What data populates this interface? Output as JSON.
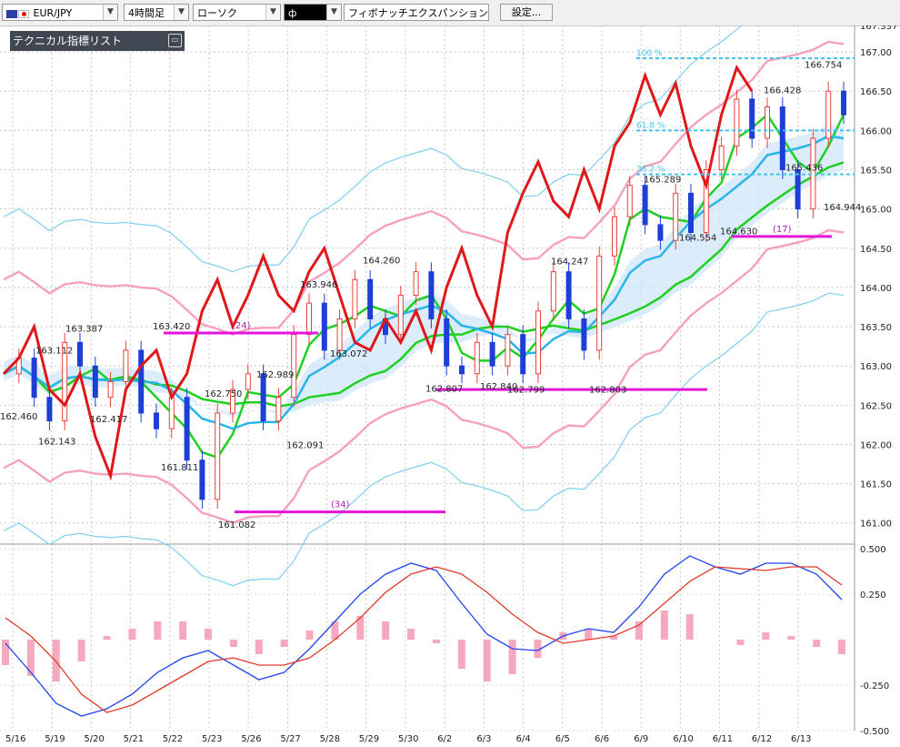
{
  "toolbar": {
    "pair": "EUR/JPY",
    "timeframe": "4時間足",
    "chart_style": "ローソク",
    "draw_tool_label": "ф",
    "draw_tool_name": "フィボナッチエクスパンション",
    "settings_label": "設定..."
  },
  "indicator_list": {
    "label": "テクニカル指標リスト"
  },
  "colors": {
    "candle_up": "#e8413a",
    "candle_down": "#1d3fd6",
    "ma_green": "#20d020",
    "ma_blue": "#2ab4e8",
    "bollinger_pink": "#f6a0bf",
    "bollinger_blue": "#7fcfef",
    "red_line": "#e01818",
    "cloud_pink": "#f9c8d9",
    "cloud_blue": "#cfe6f9",
    "fib": "#3cc4f0",
    "magenta": "#e414dc"
  },
  "chart_data": [
    {
      "type": "candlestick",
      "y_axis_labels": [
        "167.337",
        "167.00",
        "166.50",
        "166.00",
        "165.50",
        "165.00",
        "164.50",
        "164.00",
        "163.50",
        "163.00",
        "162.50",
        "162.00",
        "161.50",
        "161.00"
      ],
      "ylim": [
        160.8,
        167.337
      ],
      "x_labels": [
        "5/16",
        "5/19",
        "5/20",
        "5/21",
        "5/22",
        "5/23",
        "5/26",
        "5/27",
        "5/28",
        "5/29",
        "5/30",
        "6/2",
        "6/3",
        "6/4",
        "6/5",
        "6/6",
        "6/9",
        "6/10",
        "6/11",
        "6/12",
        "6/13"
      ],
      "price_annotations": [
        {
          "text": "162.460",
          "x": 0,
          "y": 162.46
        },
        {
          "text": "163.112",
          "x": 1.3,
          "y": 163.11
        },
        {
          "text": "162.143",
          "x": 1.4,
          "y": 162.14
        },
        {
          "text": "163.387",
          "x": 2.4,
          "y": 163.39
        },
        {
          "text": "162.417",
          "x": 3.3,
          "y": 162.42
        },
        {
          "text": "163.420",
          "x": 5.6,
          "y": 163.42
        },
        {
          "text": "161.811",
          "x": 5.9,
          "y": 161.81
        },
        {
          "text": "162.750",
          "x": 7.5,
          "y": 162.75
        },
        {
          "text": "161.082",
          "x": 8.0,
          "y": 161.08
        },
        {
          "text": "162.989",
          "x": 9.4,
          "y": 162.99
        },
        {
          "text": "162.091",
          "x": 10.5,
          "y": 162.09
        },
        {
          "text": "163.946",
          "x": 11.0,
          "y": 163.95
        },
        {
          "text": "163.072",
          "x": 12.1,
          "y": 163.07
        },
        {
          "text": "164.260",
          "x": 13.3,
          "y": 164.26
        },
        {
          "text": "162.807",
          "x": 15.6,
          "y": 162.81
        },
        {
          "text": "162.840",
          "x": 17.6,
          "y": 162.84
        },
        {
          "text": "162.799",
          "x": 18.6,
          "y": 162.8
        },
        {
          "text": "164.247",
          "x": 20.2,
          "y": 164.25
        },
        {
          "text": "162.803",
          "x": 21.6,
          "y": 162.8
        },
        {
          "text": "165.289",
          "x": 23.6,
          "y": 165.29
        },
        {
          "text": "164.554",
          "x": 24.9,
          "y": 164.55
        },
        {
          "text": "164.630",
          "x": 26.4,
          "y": 164.63
        },
        {
          "text": "166.428",
          "x": 28.0,
          "y": 166.43
        },
        {
          "text": "165.436",
          "x": 28.8,
          "y": 165.44
        },
        {
          "text": "166.754",
          "x": 29.5,
          "y": 166.75
        },
        {
          "text": "164.944",
          "x": 30.2,
          "y": 164.94
        }
      ],
      "fib_levels": [
        {
          "label": "100 %",
          "value": 166.92
        },
        {
          "label": "61.8 %",
          "value": 166.0
        },
        {
          "label": "38.2 %",
          "value": 165.44
        }
      ],
      "counts": [
        {
          "text": "(24)",
          "y": 163.42
        },
        {
          "text": "(34)",
          "y": 161.14
        },
        {
          "text": "(17)",
          "y": 164.65
        }
      ]
    },
    {
      "type": "line",
      "title": "",
      "y_axis_labels": [
        "0.500",
        "0.250",
        "-0.250",
        "-0.500"
      ],
      "ylim": [
        -0.5,
        0.5
      ],
      "series": [
        {
          "name": "",
          "color": "#2244ee",
          "values": [
            -0.02,
            -0.18,
            -0.35,
            -0.42,
            -0.38,
            -0.3,
            -0.18,
            -0.1,
            -0.06,
            -0.14,
            -0.22,
            -0.18,
            -0.05,
            0.1,
            0.25,
            0.36,
            0.42,
            0.38,
            0.2,
            0.03,
            -0.05,
            -0.06,
            0.02,
            0.06,
            0.04,
            0.18,
            0.36,
            0.46,
            0.4,
            0.36,
            0.42,
            0.42,
            0.36,
            0.22
          ]
        },
        {
          "name": "",
          "color": "#e03a2a",
          "values": [
            0.12,
            0.02,
            -0.12,
            -0.3,
            -0.4,
            -0.36,
            -0.28,
            -0.2,
            -0.12,
            -0.1,
            -0.14,
            -0.14,
            -0.1,
            0.0,
            0.12,
            0.26,
            0.36,
            0.4,
            0.36,
            0.26,
            0.14,
            0.04,
            -0.02,
            0.0,
            0.02,
            0.08,
            0.2,
            0.32,
            0.4,
            0.39,
            0.38,
            0.4,
            0.4,
            0.3
          ]
        }
      ],
      "histogram": [
        -0.14,
        -0.2,
        -0.23,
        -0.12,
        0.02,
        0.06,
        0.1,
        0.1,
        0.06,
        -0.04,
        -0.08,
        -0.04,
        0.05,
        0.1,
        0.13,
        0.1,
        0.06,
        -0.02,
        -0.16,
        -0.23,
        -0.19,
        -0.1,
        0.04,
        0.06,
        0.02,
        0.1,
        0.16,
        0.14,
        0.0,
        -0.03,
        0.04,
        0.02,
        -0.04,
        -0.08
      ]
    }
  ]
}
